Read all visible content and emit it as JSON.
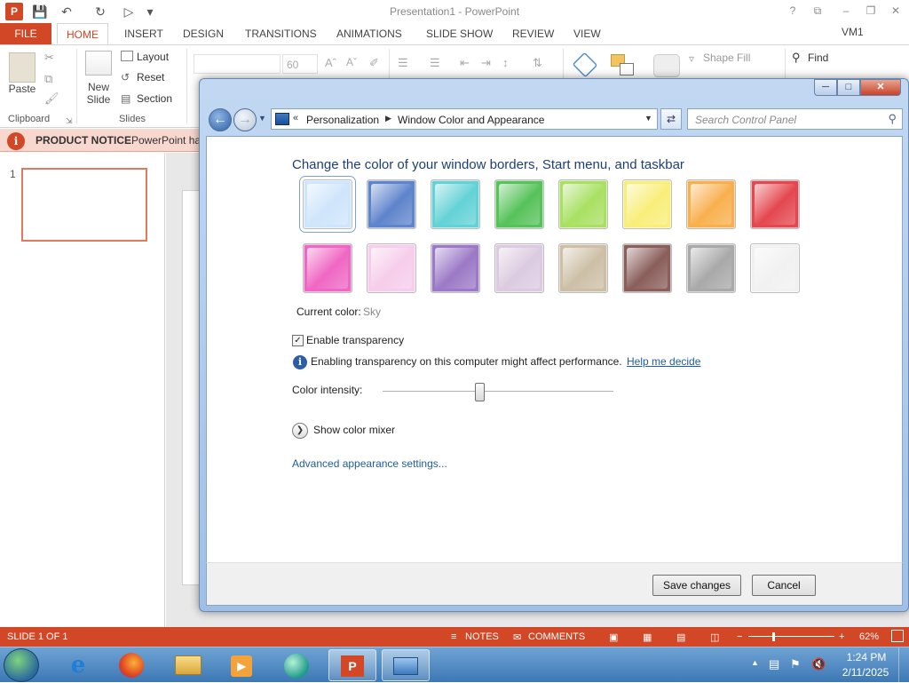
{
  "app": {
    "title": "Presentation1 - PowerPoint",
    "logo": "P",
    "user": "VM1",
    "window_buttons": [
      "?",
      "⧉",
      "–",
      "❐",
      "✕"
    ]
  },
  "tabs": [
    "FILE",
    "HOME",
    "INSERT",
    "DESIGN",
    "TRANSITIONS",
    "ANIMATIONS",
    "SLIDE SHOW",
    "REVIEW",
    "VIEW"
  ],
  "ribbon": {
    "paste": "Paste",
    "clipboard": "Clipboard",
    "new_slide": "New\nSlide",
    "layout": "Layout",
    "reset": "Reset",
    "section": "Section",
    "slides": "Slides",
    "font_size": "60",
    "shape_fill": "Shape Fill",
    "find": "Find"
  },
  "notice": {
    "title": "PRODUCT NOTICE",
    "text": "PowerPoint ha"
  },
  "slides_pane": {
    "number": "1"
  },
  "dialog": {
    "breadcrumb_root": "Personalization",
    "breadcrumb_current": "Window Color and Appearance",
    "search_placeholder": "Search Control Panel",
    "heading": "Change the color of your window borders, Start menu, and taskbar",
    "current_color_label": "Current color:",
    "current_color_value": "Sky",
    "transparency_label": "Enable transparency",
    "transparency_checked": true,
    "info_text": "Enabling transparency on this computer might affect performance.",
    "help_link": "Help me decide",
    "intensity_label": "Color intensity:",
    "intensity_value": 0.42,
    "mixer_label": "Show color mixer",
    "advanced_link": "Advanced appearance settings...",
    "save_button": "Save changes",
    "cancel_button": "Cancel",
    "swatches": [
      {
        "name": "Sky",
        "color": "#cfe5fb",
        "selected": true
      },
      {
        "name": "Twilight",
        "color": "#5f84cc"
      },
      {
        "name": "Sea",
        "color": "#63d2d6"
      },
      {
        "name": "Leaf",
        "color": "#56c25a"
      },
      {
        "name": "Lime",
        "color": "#a9e062"
      },
      {
        "name": "Lemon",
        "color": "#f9ee7a"
      },
      {
        "name": "Pumpkin",
        "color": "#f8b04e"
      },
      {
        "name": "Ruby",
        "color": "#e4474f"
      },
      {
        "name": "Fuchsia",
        "color": "#ef67c3"
      },
      {
        "name": "Blush",
        "color": "#f6cdea"
      },
      {
        "name": "Violet",
        "color": "#9b79c6"
      },
      {
        "name": "Lavender",
        "color": "#dccbe0"
      },
      {
        "name": "Taupe",
        "color": "#cdbfa6"
      },
      {
        "name": "Chocolate",
        "color": "#8a5e5b"
      },
      {
        "name": "Slate",
        "color": "#a9a9a9"
      },
      {
        "name": "Frost",
        "color": "#f1f1f1"
      }
    ]
  },
  "statusbar": {
    "slide_info": "SLIDE 1 OF 1",
    "notes": "NOTES",
    "comments": "COMMENTS",
    "zoom": "62%"
  },
  "taskbar": {
    "time": "1:24 PM",
    "date": "2/11/2025"
  },
  "colors": {
    "accent": "#d24726",
    "dialog_frame": "#b4cdee"
  }
}
